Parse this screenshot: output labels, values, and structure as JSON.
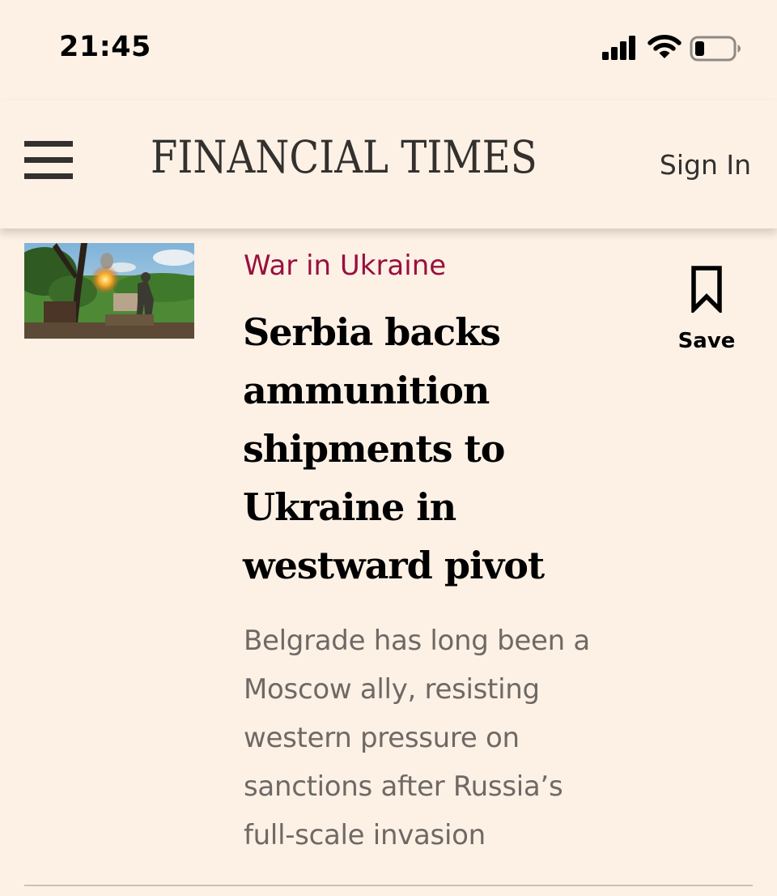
{
  "status_bar": {
    "time": "21:45",
    "signal_icon": "cellular-signal-icon",
    "wifi_icon": "wifi-icon",
    "battery_icon": "battery-low-icon"
  },
  "header": {
    "menu_icon": "hamburger-menu-icon",
    "brand": "FINANCIAL TIMES",
    "sign_in_label": "Sign In"
  },
  "article": {
    "topic": "War in Ukraine",
    "headline": "Serbia backs ammunition shipments to Ukraine in westward pivot",
    "standfirst": "Belgrade has long been a Moscow ally, resisting western pressure on sanctions after Russia’s full-scale invasion",
    "save_label": "Save",
    "save_icon": "bookmark-icon",
    "thumbnail": "soldier-firing-mortar-photo"
  },
  "colors": {
    "background": "#FDF1E6",
    "topic": "#990F3D",
    "brand": "#33302E",
    "standfirst": "#6F6965",
    "divider": "#CCC1B7"
  }
}
